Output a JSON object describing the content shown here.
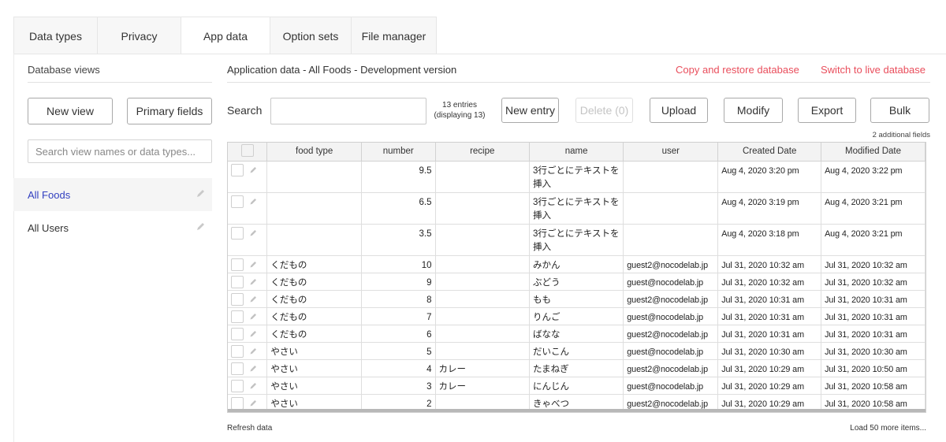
{
  "tabs": [
    {
      "label": "Data types"
    },
    {
      "label": "Privacy"
    },
    {
      "label": "App data",
      "active": true
    },
    {
      "label": "Option sets"
    },
    {
      "label": "File manager"
    }
  ],
  "sidebar": {
    "title": "Database views",
    "new_view": "New view",
    "primary_fields": "Primary fields",
    "search_placeholder": "Search view names or data types...",
    "views": [
      {
        "label": "All Foods",
        "selected": true
      },
      {
        "label": "All Users",
        "selected": false
      }
    ]
  },
  "main": {
    "title": "Application data - All Foods - Development version",
    "copy_restore": "Copy and restore database",
    "switch_live": "Switch to live database",
    "search_label": "Search",
    "entries_count": "13 entries",
    "entries_display": "(displaying 13)",
    "buttons": {
      "new_entry": "New entry",
      "delete": "Delete (0)",
      "upload": "Upload",
      "modify": "Modify",
      "export": "Export",
      "bulk": "Bulk"
    },
    "additional_fields": "2 additional fields",
    "refresh": "Refresh data",
    "load_more": "Load 50 more items..."
  },
  "table": {
    "columns": [
      "food type",
      "number",
      "recipe",
      "name",
      "user",
      "Created Date",
      "Modified Date"
    ],
    "rows": [
      [
        "",
        "9.5",
        "",
        "3行ごとにテキストを挿入",
        "",
        "Aug 4, 2020 3:20 pm",
        "Aug 4, 2020 3:22 pm"
      ],
      [
        "",
        "6.5",
        "",
        "3行ごとにテキストを挿入",
        "",
        "Aug 4, 2020 3:19 pm",
        "Aug 4, 2020 3:21 pm"
      ],
      [
        "",
        "3.5",
        "",
        "3行ごとにテキストを挿入",
        "",
        "Aug 4, 2020 3:18 pm",
        "Aug 4, 2020 3:21 pm"
      ],
      [
        "くだもの",
        "10",
        "",
        "みかん",
        "guest2@nocodelab.jp",
        "Jul 31, 2020 10:32 am",
        "Jul 31, 2020 10:32 am"
      ],
      [
        "くだもの",
        "9",
        "",
        "ぶどう",
        "guest@nocodelab.jp",
        "Jul 31, 2020 10:32 am",
        "Jul 31, 2020 10:32 am"
      ],
      [
        "くだもの",
        "8",
        "",
        "もも",
        "guest2@nocodelab.jp",
        "Jul 31, 2020 10:31 am",
        "Jul 31, 2020 10:31 am"
      ],
      [
        "くだもの",
        "7",
        "",
        "りんご",
        "guest@nocodelab.jp",
        "Jul 31, 2020 10:31 am",
        "Jul 31, 2020 10:31 am"
      ],
      [
        "くだもの",
        "6",
        "",
        "ばなな",
        "guest2@nocodelab.jp",
        "Jul 31, 2020 10:31 am",
        "Jul 31, 2020 10:31 am"
      ],
      [
        "やさい",
        "5",
        "",
        "だいこん",
        "guest@nocodelab.jp",
        "Jul 31, 2020 10:30 am",
        "Jul 31, 2020 10:30 am"
      ],
      [
        "やさい",
        "4",
        "カレー",
        "たまねぎ",
        "guest2@nocodelab.jp",
        "Jul 31, 2020 10:29 am",
        "Jul 31, 2020 10:50 am"
      ],
      [
        "やさい",
        "3",
        "カレー",
        "にんじん",
        "guest@nocodelab.jp",
        "Jul 31, 2020 10:29 am",
        "Jul 31, 2020 10:58 am"
      ],
      [
        "やさい",
        "2",
        "",
        "きゃべつ",
        "guest2@nocodelab.jp",
        "Jul 31, 2020 10:29 am",
        "Jul 31, 2020 10:58 am"
      ]
    ]
  },
  "colors": {
    "accent_link": "#e94e5c",
    "selected_view": "#3240c0"
  },
  "icons": {
    "edit": "pencil-icon"
  }
}
